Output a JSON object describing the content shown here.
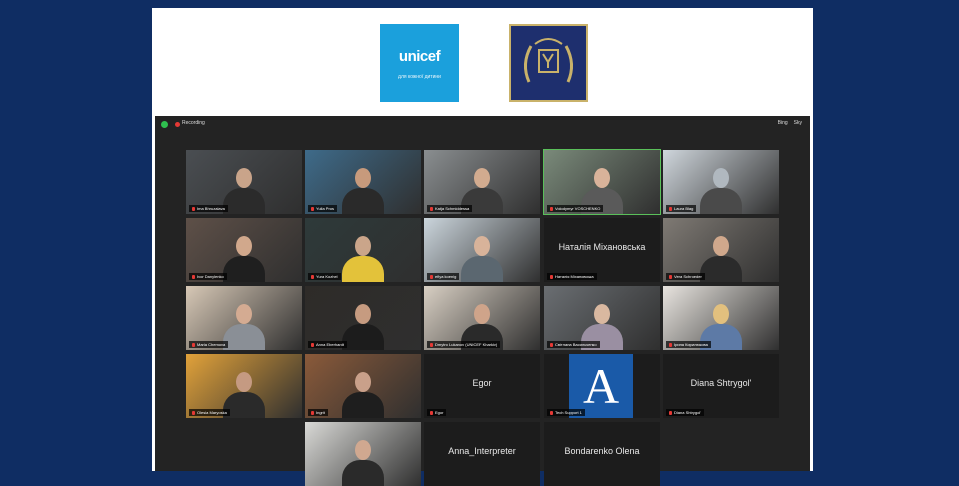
{
  "zoom": {
    "recording_label": "Recording",
    "top_right": [
      "Bing",
      "Sky"
    ]
  },
  "logos": {
    "unicef_word": "unicef",
    "unicef_tagline": "для кожної дитини"
  },
  "participants": [
    {
      "name": "Ima Bhruzalava",
      "type": "video"
    },
    {
      "name": "Yulia Pros",
      "type": "video"
    },
    {
      "name": "Katja Schmiddessa",
      "type": "video"
    },
    {
      "name": "Volodymyr VOSCHENKO",
      "type": "video"
    },
    {
      "name": "Laura Blag",
      "type": "video"
    },
    {
      "name": "Ivor Danylenko",
      "type": "video"
    },
    {
      "name": "Yura Kozhel",
      "type": "video"
    },
    {
      "name": "efiya koenig",
      "type": "video"
    },
    {
      "name": "Наталія Міхановська",
      "type": "name",
      "display": "Наталія Міхановська"
    },
    {
      "name": "Vera Schroeder",
      "type": "video"
    },
    {
      "name": "Maria Chemova",
      "type": "video"
    },
    {
      "name": "Anna Eberhardt",
      "type": "video"
    },
    {
      "name": "Dmytro Lukanov (UNICEF Kharkiv)",
      "type": "video"
    },
    {
      "name": "Світлана Васильченко",
      "type": "video"
    },
    {
      "name": "Ірина Кирилюкова",
      "type": "video"
    },
    {
      "name": "Olesia Maryoska",
      "type": "video"
    },
    {
      "name": "Ingrit",
      "type": "video"
    },
    {
      "name": "Egor",
      "type": "name",
      "display": "Egor"
    },
    {
      "name": "Tech Support 1",
      "type": "avatar",
      "display": "A"
    },
    {
      "name": "Diana Shtrygol'",
      "type": "name",
      "display": "Diana Shtrygol'"
    },
    {
      "name": "",
      "type": "video"
    },
    {
      "name": "",
      "type": "name",
      "display": "Anna_Interpreter"
    },
    {
      "name": "",
      "type": "name",
      "display": "Bondarenko Olena"
    }
  ]
}
